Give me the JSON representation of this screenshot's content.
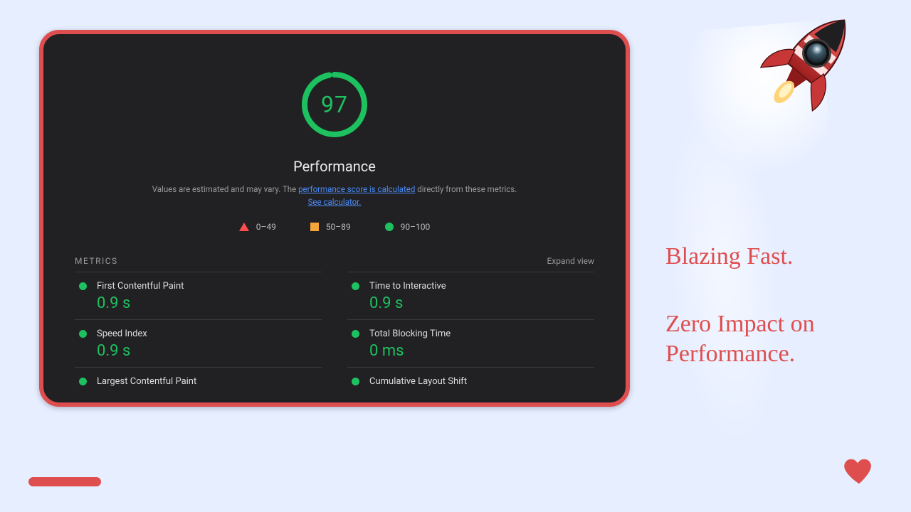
{
  "lighthouse": {
    "score": "97",
    "title": "Performance",
    "subtext_prefix": "Values are estimated and may vary. The ",
    "link_calc": "performance score is calculated",
    "subtext_mid": " directly from these metrics. ",
    "link_see": "See calculator.",
    "legend": {
      "poor": "0–49",
      "avg": "50–89",
      "good": "90–100"
    },
    "metrics_label": "METRICS",
    "expand_label": "Expand view",
    "metrics": [
      {
        "name": "First Contentful Paint",
        "value": "0.9 s"
      },
      {
        "name": "Time to Interactive",
        "value": "0.9 s"
      },
      {
        "name": "Speed Index",
        "value": "0.9 s"
      },
      {
        "name": "Total Blocking Time",
        "value": "0 ms"
      },
      {
        "name": "Largest Contentful Paint",
        "value": ""
      },
      {
        "name": "Cumulative Layout Shift",
        "value": ""
      }
    ]
  },
  "marketing": {
    "line1": "Blazing Fast.",
    "line2": "Zero Impact on Performance."
  },
  "icons": {
    "rocket": "rocket-icon",
    "heart": "heart-icon"
  },
  "colors": {
    "accent": "#df4e4e",
    "good": "#1ec15f",
    "warn": "#f6a43c",
    "bad": "#ff4d4f",
    "panel": "#212124"
  }
}
